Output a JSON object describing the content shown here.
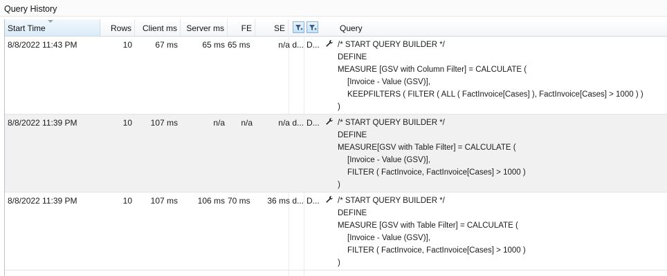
{
  "panel": {
    "title": "Query History"
  },
  "columns": {
    "start_time": "Start Time",
    "rows": "Rows",
    "client_ms": "Client ms",
    "server_ms": "Server ms",
    "fe": "FE",
    "se": "SE",
    "query": "Query"
  },
  "filter_buttons": [
    {
      "icon": "filter-icon"
    },
    {
      "icon": "filter-icon"
    }
  ],
  "rows": [
    {
      "start_time": "8/8/2022 11:43 PM",
      "rows": "10",
      "client_ms": "67 ms",
      "server_ms": "65 ms",
      "fe": "65 ms",
      "se": "n/a d...",
      "db": "D...",
      "query": {
        "l1": "/* START QUERY BUILDER */",
        "l2": "DEFINE",
        "l3_kw": "MEASURE",
        "l3_rest": "[GSV with Column Filter] = CALCULATE (",
        "l4": "[Invoice - Value (GSV)],",
        "l5": "KEEPFILTERS ( FILTER ( ALL ( FactInvoice[Cases] ), FactInvoice[Cases] > 1000 ) )",
        "l6": ")"
      }
    },
    {
      "start_time": "8/8/2022 11:39 PM",
      "rows": "10",
      "client_ms": "107 ms",
      "server_ms": "n/a",
      "fe": "n/a",
      "se": "n/a d...",
      "db": "D...",
      "query": {
        "l1": "/* START QUERY BUILDER */",
        "l2": "DEFINE",
        "l3_kw": "MEASURE",
        "l3_rest": "[GSV with Table Filter] = CALCULATE (",
        "l4": "[Invoice - Value (GSV)],",
        "l5": "FILTER ( FactInvoice, FactInvoice[Cases] > 1000 )",
        "l6": ")"
      }
    },
    {
      "start_time": "8/8/2022 11:39 PM",
      "rows": "10",
      "client_ms": "107 ms",
      "server_ms": "106 ms",
      "fe": "70 ms",
      "se": "36 ms d...",
      "db": "D...",
      "query": {
        "l1": "/* START QUERY BUILDER */",
        "l2": "DEFINE",
        "l3_kw": "MEASURE",
        "l3_rest": "[GSV with Table Filter] = CALCULATE (",
        "l4": "[Invoice - Value (GSV)],",
        "l5": "FILTER ( FactInvoice, FactInvoice[Cases] > 1000 )",
        "l6": ")"
      }
    }
  ],
  "icons": {
    "row_action": "wrench-icon",
    "filter": "filter-icon"
  }
}
